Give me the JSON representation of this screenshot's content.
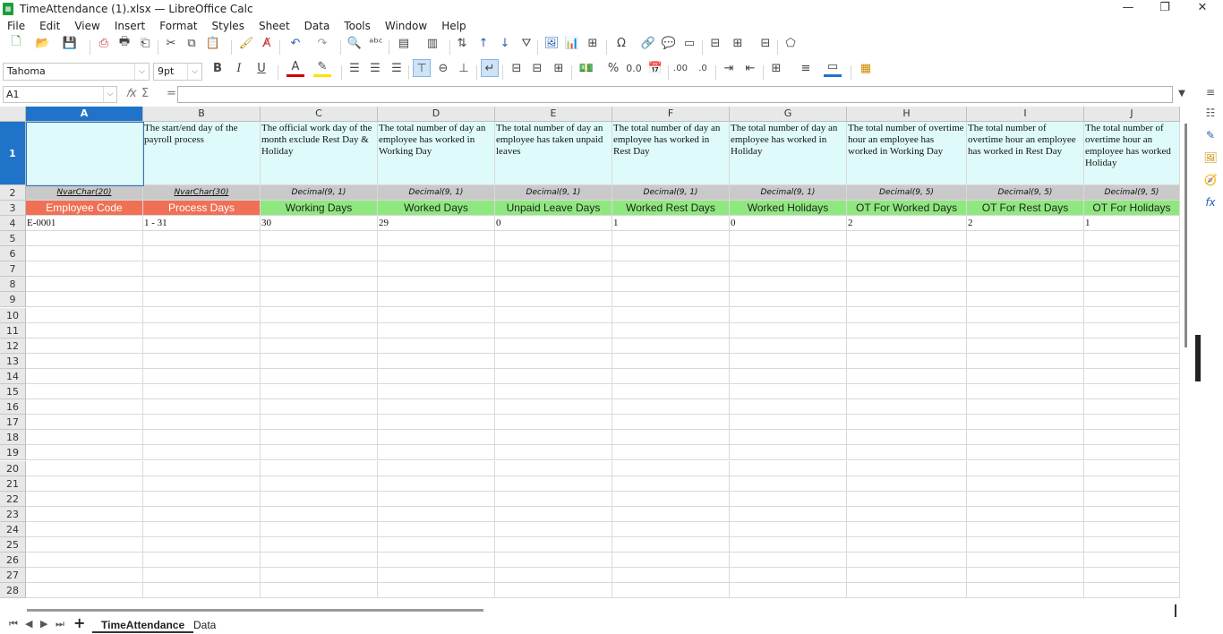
{
  "window": {
    "title": "TimeAttendance (1).xlsx — LibreOffice Calc",
    "minimize": "—",
    "maximize": "❐",
    "close": "✕"
  },
  "menu": [
    "File",
    "Edit",
    "View",
    "Insert",
    "Format",
    "Styles",
    "Sheet",
    "Data",
    "Tools",
    "Window",
    "Help"
  ],
  "font": {
    "name": "Tahoma",
    "size": "9pt"
  },
  "namebox": "A1",
  "formula": "",
  "columns": [
    "A",
    "B",
    "C",
    "D",
    "E",
    "F",
    "G",
    "H",
    "I",
    "J"
  ],
  "rows": [
    "1",
    "2",
    "3",
    "4",
    "5",
    "6",
    "7",
    "8",
    "9",
    "10",
    "11",
    "12",
    "13",
    "14",
    "15",
    "16",
    "17",
    "18",
    "19",
    "20",
    "21",
    "22",
    "23",
    "24",
    "25",
    "26",
    "27",
    "28"
  ],
  "row1": [
    "",
    "The start/end day of the payroll process",
    "The official work day of the month exclude Rest Day &  Holiday",
    "The total number of day an employee has worked in Working Day",
    "The total number of day an employee has taken unpaid leaves",
    "The total number of day an employee has worked in Rest Day",
    "The total number of day an employee has worked in Holiday",
    "The total number of overtime hour an employee has worked in Working Day",
    "The total number of overtime hour an employee has worked in Rest Day",
    "The total number of overtime hour an employee has worked Holiday"
  ],
  "row2": [
    "NvarChar(20)",
    "NvarChar(30)",
    "Decimal(9, 1)",
    "Decimal(9, 1)",
    "Decimal(9, 1)",
    "Decimal(9, 1)",
    "Decimal(9, 1)",
    "Decimal(9, 5)",
    "Decimal(9, 5)",
    "Decimal(9, 5)"
  ],
  "row3": [
    "Employee Code",
    "Process Days",
    "Working Days",
    "Worked Days",
    "Unpaid Leave Days",
    "Worked Rest Days",
    "Worked Holidays",
    "OT For Worked Days",
    "OT For Rest Days",
    "OT For Holidays"
  ],
  "row4": [
    "E-0001",
    "1 - 31",
    "30",
    "29",
    "0",
    "1",
    "0",
    "2",
    "2",
    "1"
  ],
  "sheets": [
    "TimeAttendance",
    "Data"
  ],
  "colors": {
    "selection": "#1f74c9",
    "header_row": "#dffafa",
    "type_row": "#c9c9c9",
    "key_label": "#f07055",
    "value_label": "#8fe87f"
  }
}
